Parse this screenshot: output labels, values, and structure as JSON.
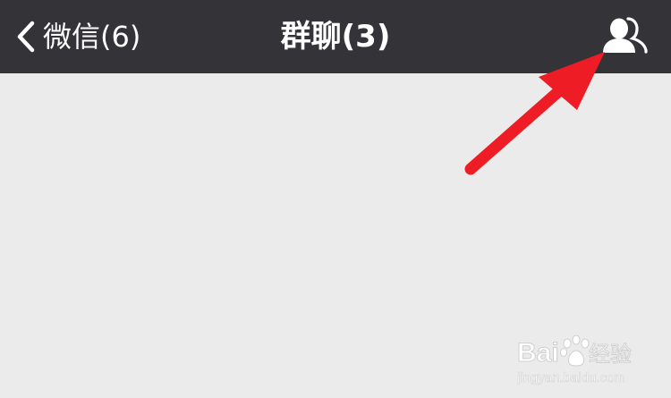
{
  "nav_bar": {
    "back_label": "微信(6)",
    "title": "群聊(3)",
    "back_icon": "chevron-left-icon",
    "members_icon": "group-members-icon",
    "background_color": "#333338",
    "text_color": "#ffffff"
  },
  "chat_body": {
    "background_color": "#ebebeb"
  },
  "annotation": {
    "arrow_color": "#ee1c25",
    "target": "group-members-button"
  },
  "watermark": {
    "brand": "Baidu经验",
    "url": "jingyan.baidu.com"
  }
}
